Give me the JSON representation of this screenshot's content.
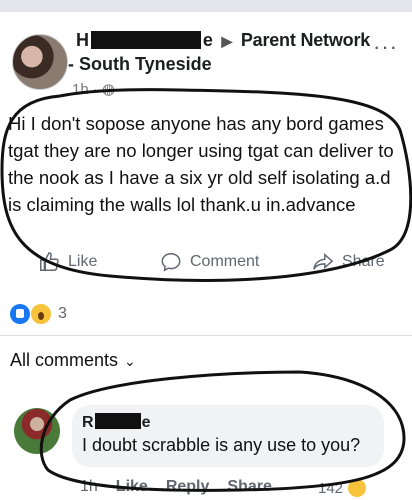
{
  "post": {
    "author_start": "H",
    "author_end": "e",
    "group": "Parent Network",
    "location": "- South Tyneside",
    "time": "1h",
    "text": "Hi I don't sopose anyone has any bord games tgat they are no longer using tgat can deliver to the nook as I have a six yr old self isolating a.d is claiming the walls lol  thank.u in.advance"
  },
  "actions": {
    "like": "Like",
    "comment": "Comment",
    "share": "Share"
  },
  "reactions": {
    "count": "3"
  },
  "comments": {
    "header": "All comments",
    "author_start": "R",
    "author_end": "e",
    "text": "I doubt scrabble is any use to you?",
    "time": "1h",
    "like": "Like",
    "reply": "Reply",
    "share": "Share",
    "reaction_count": "142"
  },
  "colors": {
    "accent": "#1877f2",
    "meta": "#606770",
    "bubble": "#f0f2f5"
  }
}
